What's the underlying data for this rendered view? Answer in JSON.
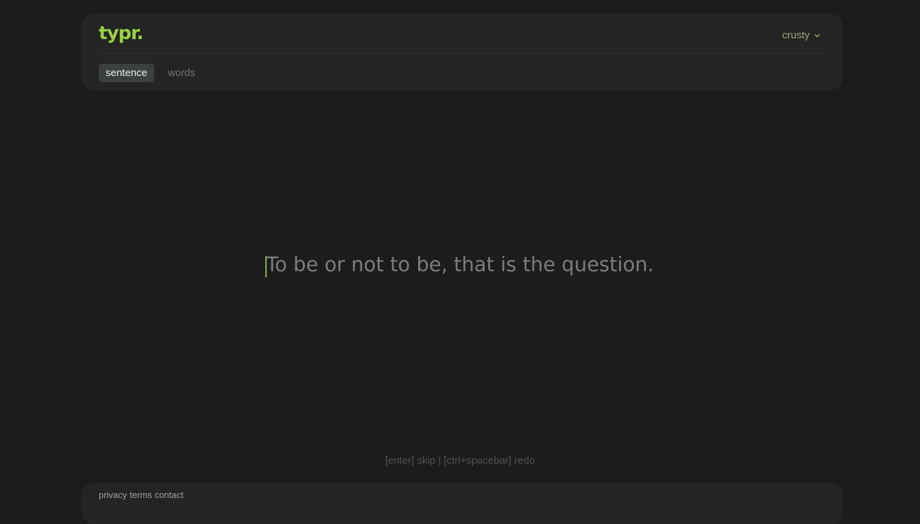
{
  "header": {
    "logo": "typr.",
    "user_menu": {
      "label": "crusty",
      "icon": "chevron-down-icon"
    },
    "tabs": [
      {
        "label": "sentence",
        "active": true
      },
      {
        "label": "words",
        "active": false
      }
    ]
  },
  "main": {
    "prompt_text": "To be or not to be, that is the question."
  },
  "hints": "[enter] skip | [ctrl+spacebar] redo",
  "footer": {
    "links": [
      "privacy",
      "terms",
      "contact"
    ]
  },
  "colors": {
    "accent": "#9bd243",
    "background": "#1c1c1b",
    "panel": "#242423"
  }
}
